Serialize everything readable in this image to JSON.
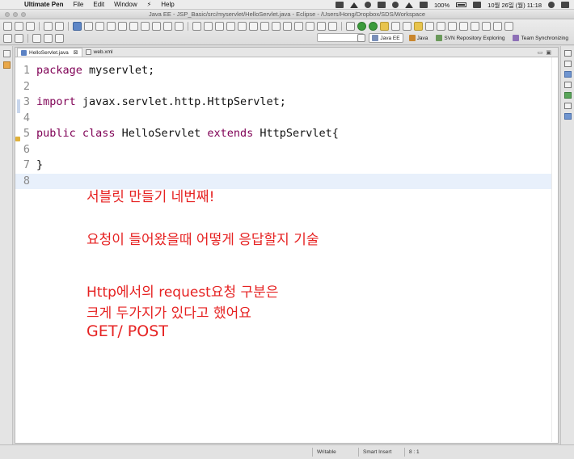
{
  "menubar": {
    "app_name": "Ultimate Pen",
    "items": [
      "File",
      "Edit",
      "Window",
      "Help"
    ],
    "battery": "100%",
    "datetime": "10월 26일 (월) 11:18"
  },
  "window": {
    "title": "Java EE - JSP_Basic/src/myservlet/HelloServlet.java - Eclipse - /Users/Hong/Dropbox/SDS/Workspace"
  },
  "perspectives": [
    {
      "label": "Java EE",
      "icon": "java-ee-icon",
      "active": true
    },
    {
      "label": "Java",
      "icon": "java-icon",
      "active": false
    },
    {
      "label": "SVN Repository Exploring",
      "icon": "svn-icon",
      "active": false
    },
    {
      "label": "Team Synchronizing",
      "icon": "team-icon",
      "active": false
    }
  ],
  "editor": {
    "tabs": [
      {
        "label": "HelloServlet.java",
        "icon": "java-file-icon",
        "active": true
      },
      {
        "label": "web.xml",
        "icon": "xml-file-icon",
        "active": false
      }
    ],
    "lines": [
      {
        "n": "1",
        "kw": "package",
        "rest": " myservlet;",
        "kw2": "",
        "rest2": ""
      },
      {
        "n": "2",
        "kw": "",
        "rest": "",
        "kw2": "",
        "rest2": ""
      },
      {
        "n": "3",
        "kw": "import",
        "rest": " javax.servlet.http.HttpServlet;",
        "kw2": "",
        "rest2": ""
      },
      {
        "n": "4",
        "kw": "",
        "rest": "",
        "kw2": "",
        "rest2": ""
      },
      {
        "n": "5",
        "kw": "public class",
        "rest": " HelloServlet ",
        "kw2": "extends",
        "rest2": " HttpServlet{"
      },
      {
        "n": "6",
        "kw": "",
        "rest": "",
        "kw2": "",
        "rest2": ""
      },
      {
        "n": "7",
        "kw": "",
        "rest": "}",
        "kw2": "",
        "rest2": ""
      },
      {
        "n": "8",
        "kw": "",
        "rest": "",
        "kw2": "",
        "rest2": ""
      }
    ],
    "current_line": 8
  },
  "annotations": [
    "서블릿 만들기 네번째!",
    "요청이 들어왔을때 어떻게 응답할지 기술",
    "Http에서의 request요청 구분은",
    "크게 두가지가 있다고 했어요",
    "GET/ POST"
  ],
  "statusbar": {
    "mode": "Writable",
    "insert": "Smart Insert",
    "position": "8 : 1"
  },
  "colors": {
    "keyword": "#7f0055",
    "annotation": "#e62222",
    "current_line": "#e8f0fb"
  }
}
